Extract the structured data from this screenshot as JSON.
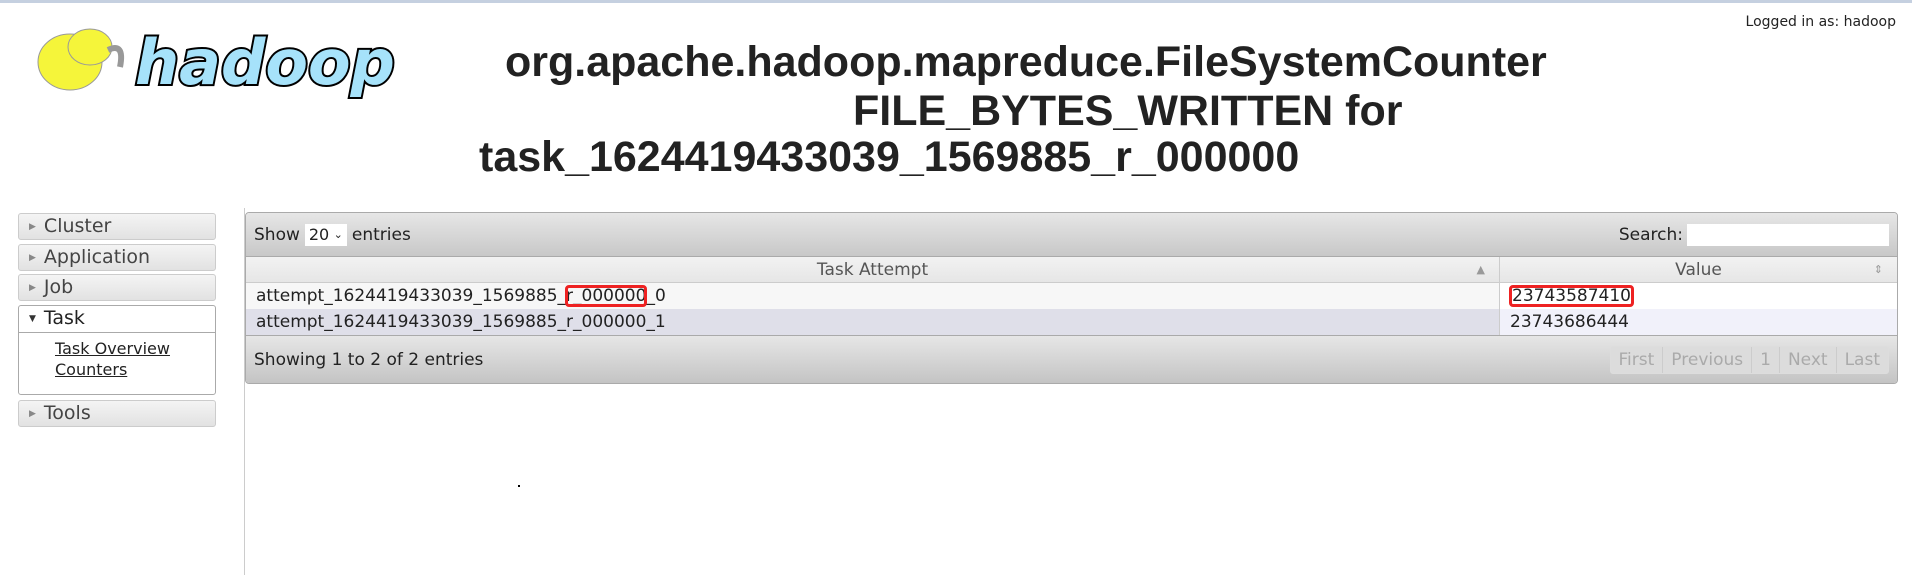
{
  "header": {
    "logged_in": "Logged in as: hadoop",
    "logo_text": "hadoop",
    "title_lines": [
      "org.apache.hadoop.mapreduce.FileSystemCounter",
      "FILE_BYTES_WRITTEN for",
      "task_1624419433039_1569885_r_000000"
    ]
  },
  "sidebar": {
    "items": [
      {
        "label": "Cluster"
      },
      {
        "label": "Application"
      },
      {
        "label": "Job"
      },
      {
        "label": "Task",
        "expanded": true,
        "links": [
          "Task Overview",
          "Counters"
        ]
      },
      {
        "label": "Tools"
      }
    ]
  },
  "table": {
    "show_label": "Show",
    "page_size": "20",
    "entries_label": "entries",
    "search_label": "Search:",
    "search_value": "",
    "columns": [
      "Task Attempt",
      "Value"
    ],
    "rows": [
      {
        "attempt_pre": "attempt_1624419433039_1569885_",
        "attempt_hl": "r_000000",
        "attempt_post": "_0",
        "value": "23743587410"
      },
      {
        "attempt": "attempt_1624419433039_1569885_r_000000_1",
        "value": "23743686444"
      }
    ],
    "info": "Showing 1 to 2 of 2 entries",
    "pager": [
      "First",
      "Previous",
      "1",
      "Next",
      "Last"
    ]
  },
  "colors": {
    "highlight": "#ee2222"
  }
}
